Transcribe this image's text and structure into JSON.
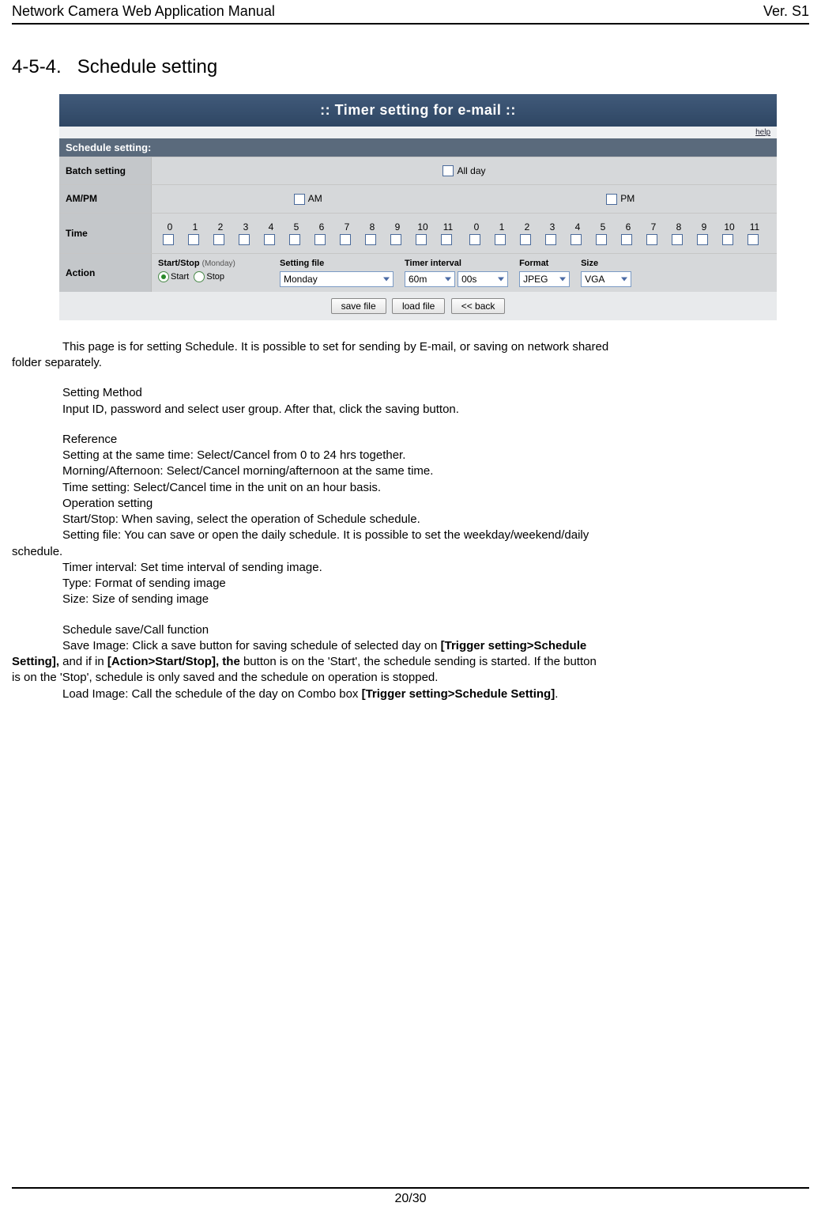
{
  "header": {
    "left": "Network Camera Web Application Manual",
    "right": "Ver. S1"
  },
  "section_number": "4-5-4.",
  "section_title": "Schedule setting",
  "ui": {
    "title_banner": ":: Timer setting for e-mail ::",
    "help_link": "help",
    "schedule_heading": "Schedule setting:",
    "rows": {
      "batch": {
        "label": "Batch setting",
        "allday": "All day"
      },
      "ampm": {
        "label": "AM/PM",
        "am": "AM",
        "pm": "PM"
      },
      "time": {
        "label": "Time",
        "hours_am": [
          "0",
          "1",
          "2",
          "3",
          "4",
          "5",
          "6",
          "7",
          "8",
          "9",
          "10",
          "11"
        ],
        "hours_pm": [
          "0",
          "1",
          "2",
          "3",
          "4",
          "5",
          "6",
          "7",
          "8",
          "9",
          "10",
          "11"
        ]
      },
      "action": {
        "label": "Action",
        "startstop_label": "Start/Stop",
        "startstop_sub": "(Monday)",
        "start": "Start",
        "stop": "Stop",
        "setting_file_label": "Setting file",
        "setting_file_value": "Monday",
        "timer_interval_label": "Timer interval",
        "timer_interval_min": "60m",
        "timer_interval_sec": "00s",
        "format_label": "Format",
        "format_value": "JPEG",
        "size_label": "Size",
        "size_value": "VGA"
      }
    },
    "buttons": {
      "save": "save file",
      "load": "load file",
      "back": "<< back"
    }
  },
  "body": {
    "p1a": "This page is for setting Schedule. It is possible to set for sending by E-mail, or saving on network shared",
    "p1b": "folder separately.",
    "setting_method_h": "Setting Method",
    "setting_method_t": "Input ID, password and select user group. After that, click the saving button.",
    "reference_h": "Reference",
    "ref_l1": "Setting at the same time: Select/Cancel from 0 to 24 hrs together.",
    "ref_l2": "Morning/Afternoon: Select/Cancel morning/afternoon at the same time.",
    "ref_l3": "Time setting: Select/Cancel time in the unit on an hour basis.",
    "ref_l4": "Operation setting",
    "ref_l5": "Start/Stop: When saving, select the operation of Schedule schedule.",
    "ref_l6a": "Setting file: You can save or open the daily schedule. It is possible to set the weekday/weekend/daily",
    "ref_l6b": "schedule.",
    "ref_l7": "Timer interval: Set time interval of sending image.",
    "ref_l8": "Type: Format of sending image",
    "ref_l9": "Size: Size of sending image",
    "sched_h": "Schedule save/Call function",
    "save_l1a": "Save Image: Click a save button for saving schedule of selected day on ",
    "save_l1b": "[Trigger setting>Schedule",
    "save_l2a": "Setting],",
    "save_l2b": " and if in ",
    "save_l2c": "[Action>Start/Stop], the",
    "save_l2d": " button is on the 'Start', the schedule sending is started. If the button",
    "save_l3": "is on the 'Stop', schedule is only saved and the schedule on operation is stopped.",
    "load_l1a": "Load Image: Call the schedule of the day on Combo box ",
    "load_l1b": "[Trigger setting>Schedule Setting]",
    "load_l1c": "."
  },
  "footer": "20/30"
}
